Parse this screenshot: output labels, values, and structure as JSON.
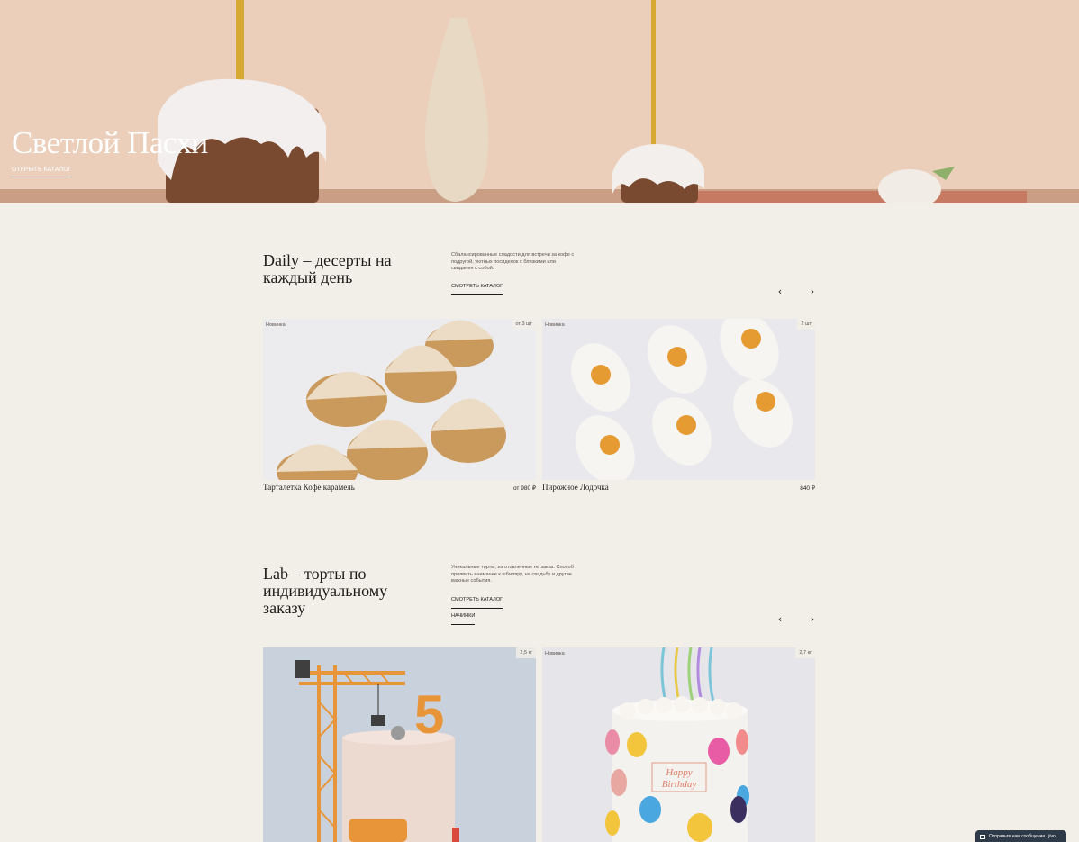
{
  "hero": {
    "title": "Светлой Пасхи",
    "link": "ОТКРЫТЬ КАТАЛОГ"
  },
  "daily": {
    "title": "Daily – десерты на каждый день",
    "description": "Сбалансированные сладости для встречи за кофе с подругой, уютных посиделок с близкими или свидания с собой.",
    "catalog_link": "СМОТРЕТЬ КАТАЛОГ",
    "prev": "‹",
    "next": "›",
    "cards": [
      {
        "badge": "Новинка",
        "quantity": "от 3 шт",
        "name": "Тарталетка Кофе карамель",
        "price": "от 980 ₽"
      },
      {
        "badge": "Новинка",
        "quantity": "2 шт",
        "name": "Пирожное Лодочка",
        "price": "840 ₽"
      }
    ]
  },
  "lab": {
    "title": "Lab – торты по индивидуальному заказу",
    "description": "Уникальные торты, изготовленные на заказ. Способ проявить внимание к юбиляру, на свадьбу и другие важные события.",
    "catalog_link": "СМОТРЕТЬ КАТАЛОГ",
    "fillings_link": "НАЧИНКИ",
    "prev": "‹",
    "next": "›",
    "cards": [
      {
        "quantity": "2,5 кг",
        "cake_number": "5"
      },
      {
        "badge": "Новинка",
        "quantity": "2,7 кг",
        "cake_text_1": "Happy",
        "cake_text_2": "Birthday"
      }
    ]
  },
  "chat": {
    "label": "Отправьте нам сообщение",
    "brand": "jivo"
  }
}
